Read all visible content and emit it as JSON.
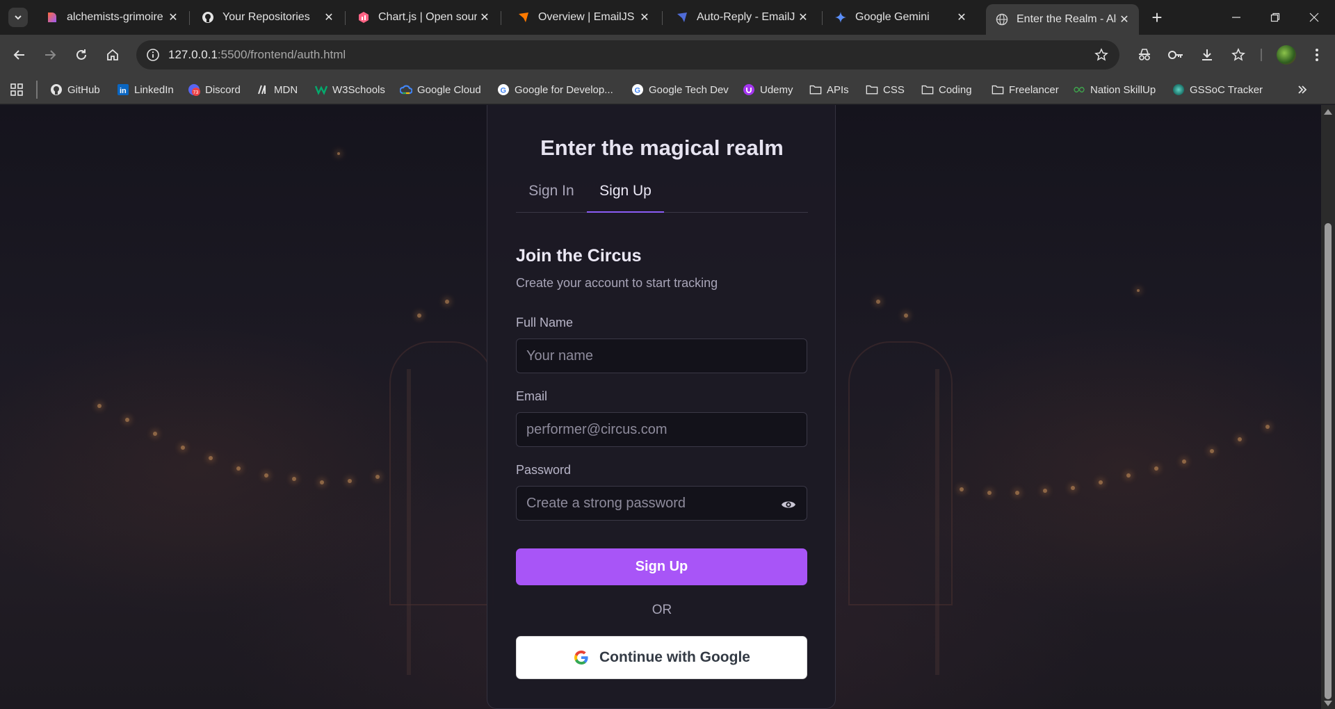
{
  "browser": {
    "tabs": [
      {
        "label": "alchemists-grimoire -",
        "icon": "lovable-icon"
      },
      {
        "label": "Your Repositories",
        "icon": "github-icon"
      },
      {
        "label": "Chart.js | Open source",
        "icon": "chartjs-icon"
      },
      {
        "label": "Overview | EmailJS",
        "icon": "emailjs-icon"
      },
      {
        "label": "Auto-Reply - EmailJS",
        "icon": "emailjs-icon"
      },
      {
        "label": "Google Gemini",
        "icon": "gemini-icon"
      },
      {
        "label": "Enter the Realm - Alc",
        "icon": "globe-icon"
      }
    ],
    "active_tab_index": 6,
    "url_host": "127.0.0.1",
    "url_path": ":5500/frontend/auth.html",
    "bookmarks": [
      {
        "label": "GitHub",
        "icon": "github-icon"
      },
      {
        "label": "LinkedIn",
        "icon": "linkedin-icon"
      },
      {
        "label": "Discord",
        "icon": "discord-icon",
        "badge": "73"
      },
      {
        "label": "MDN",
        "icon": "mdn-icon"
      },
      {
        "label": "W3Schools",
        "icon": "w3schools-icon"
      },
      {
        "label": "Google Cloud",
        "icon": "google-cloud-icon"
      },
      {
        "label": "Google for Develop...",
        "icon": "google-icon"
      },
      {
        "label": "Google Tech Dev",
        "icon": "google-icon"
      },
      {
        "label": "Udemy",
        "icon": "udemy-icon"
      },
      {
        "label": "APIs",
        "icon": "folder-icon"
      },
      {
        "label": "CSS",
        "icon": "folder-icon"
      },
      {
        "label": "Coding",
        "icon": "folder-icon"
      },
      {
        "label": "Freelancer",
        "icon": "folder-icon"
      },
      {
        "label": "Nation SkillUp",
        "icon": "nation-skillup-icon"
      },
      {
        "label": "GSSoC Tracker",
        "icon": "gssoc-icon"
      }
    ]
  },
  "auth": {
    "title": "Enter the magical realm",
    "tabs": {
      "sign_in": "Sign In",
      "sign_up": "Sign Up"
    },
    "active_tab": "sign_up",
    "form_title": "Join the Circus",
    "form_subtitle": "Create your account to start tracking",
    "fields": {
      "name": {
        "label": "Full Name",
        "placeholder": "Your name",
        "value": ""
      },
      "email": {
        "label": "Email",
        "placeholder": "performer@circus.com",
        "value": ""
      },
      "password": {
        "label": "Password",
        "placeholder": "Create a strong password",
        "value": ""
      }
    },
    "submit_label": "Sign Up",
    "divider_label": "OR",
    "google_label": "Continue with Google"
  },
  "colors": {
    "accent": "#a855f7",
    "tab_underline": "#8b5cf6",
    "card_bg": "#1c1a24",
    "chrome_bg": "#3c3c3c"
  }
}
